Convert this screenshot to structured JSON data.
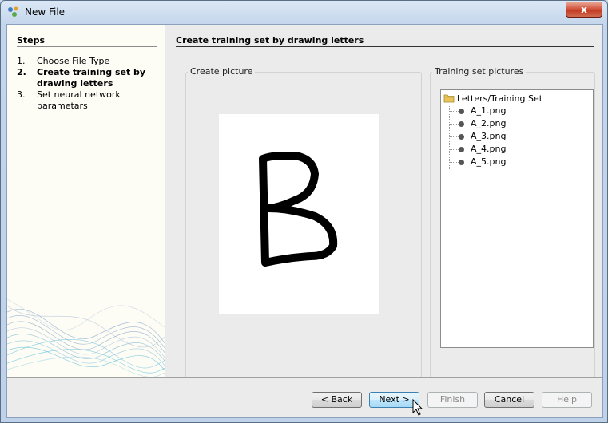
{
  "window": {
    "title": "New File",
    "close_label": "x"
  },
  "steps": {
    "title": "Steps",
    "items": [
      {
        "num": "1.",
        "label": "Choose File Type"
      },
      {
        "num": "2.",
        "label": "Create training set by drawing letters"
      },
      {
        "num": "3.",
        "label": "Set neural network parametars"
      }
    ]
  },
  "main": {
    "title": "Create training set by drawing letters",
    "create_picture_label": "Create picture",
    "training_set_label": "Training set pictures",
    "tree": {
      "root": "Letters/Training Set",
      "items": [
        "A_1.png",
        "A_2.png",
        "A_3.png",
        "A_4.png",
        "A_5.png"
      ]
    }
  },
  "buttons": {
    "back": "< Back",
    "next": "Next >",
    "finish": "Finish",
    "cancel": "Cancel",
    "help": "Help"
  },
  "icons": {
    "app": "netbeans-cube-icon",
    "folder": "folder-icon",
    "file": "file-bullet-icon"
  }
}
